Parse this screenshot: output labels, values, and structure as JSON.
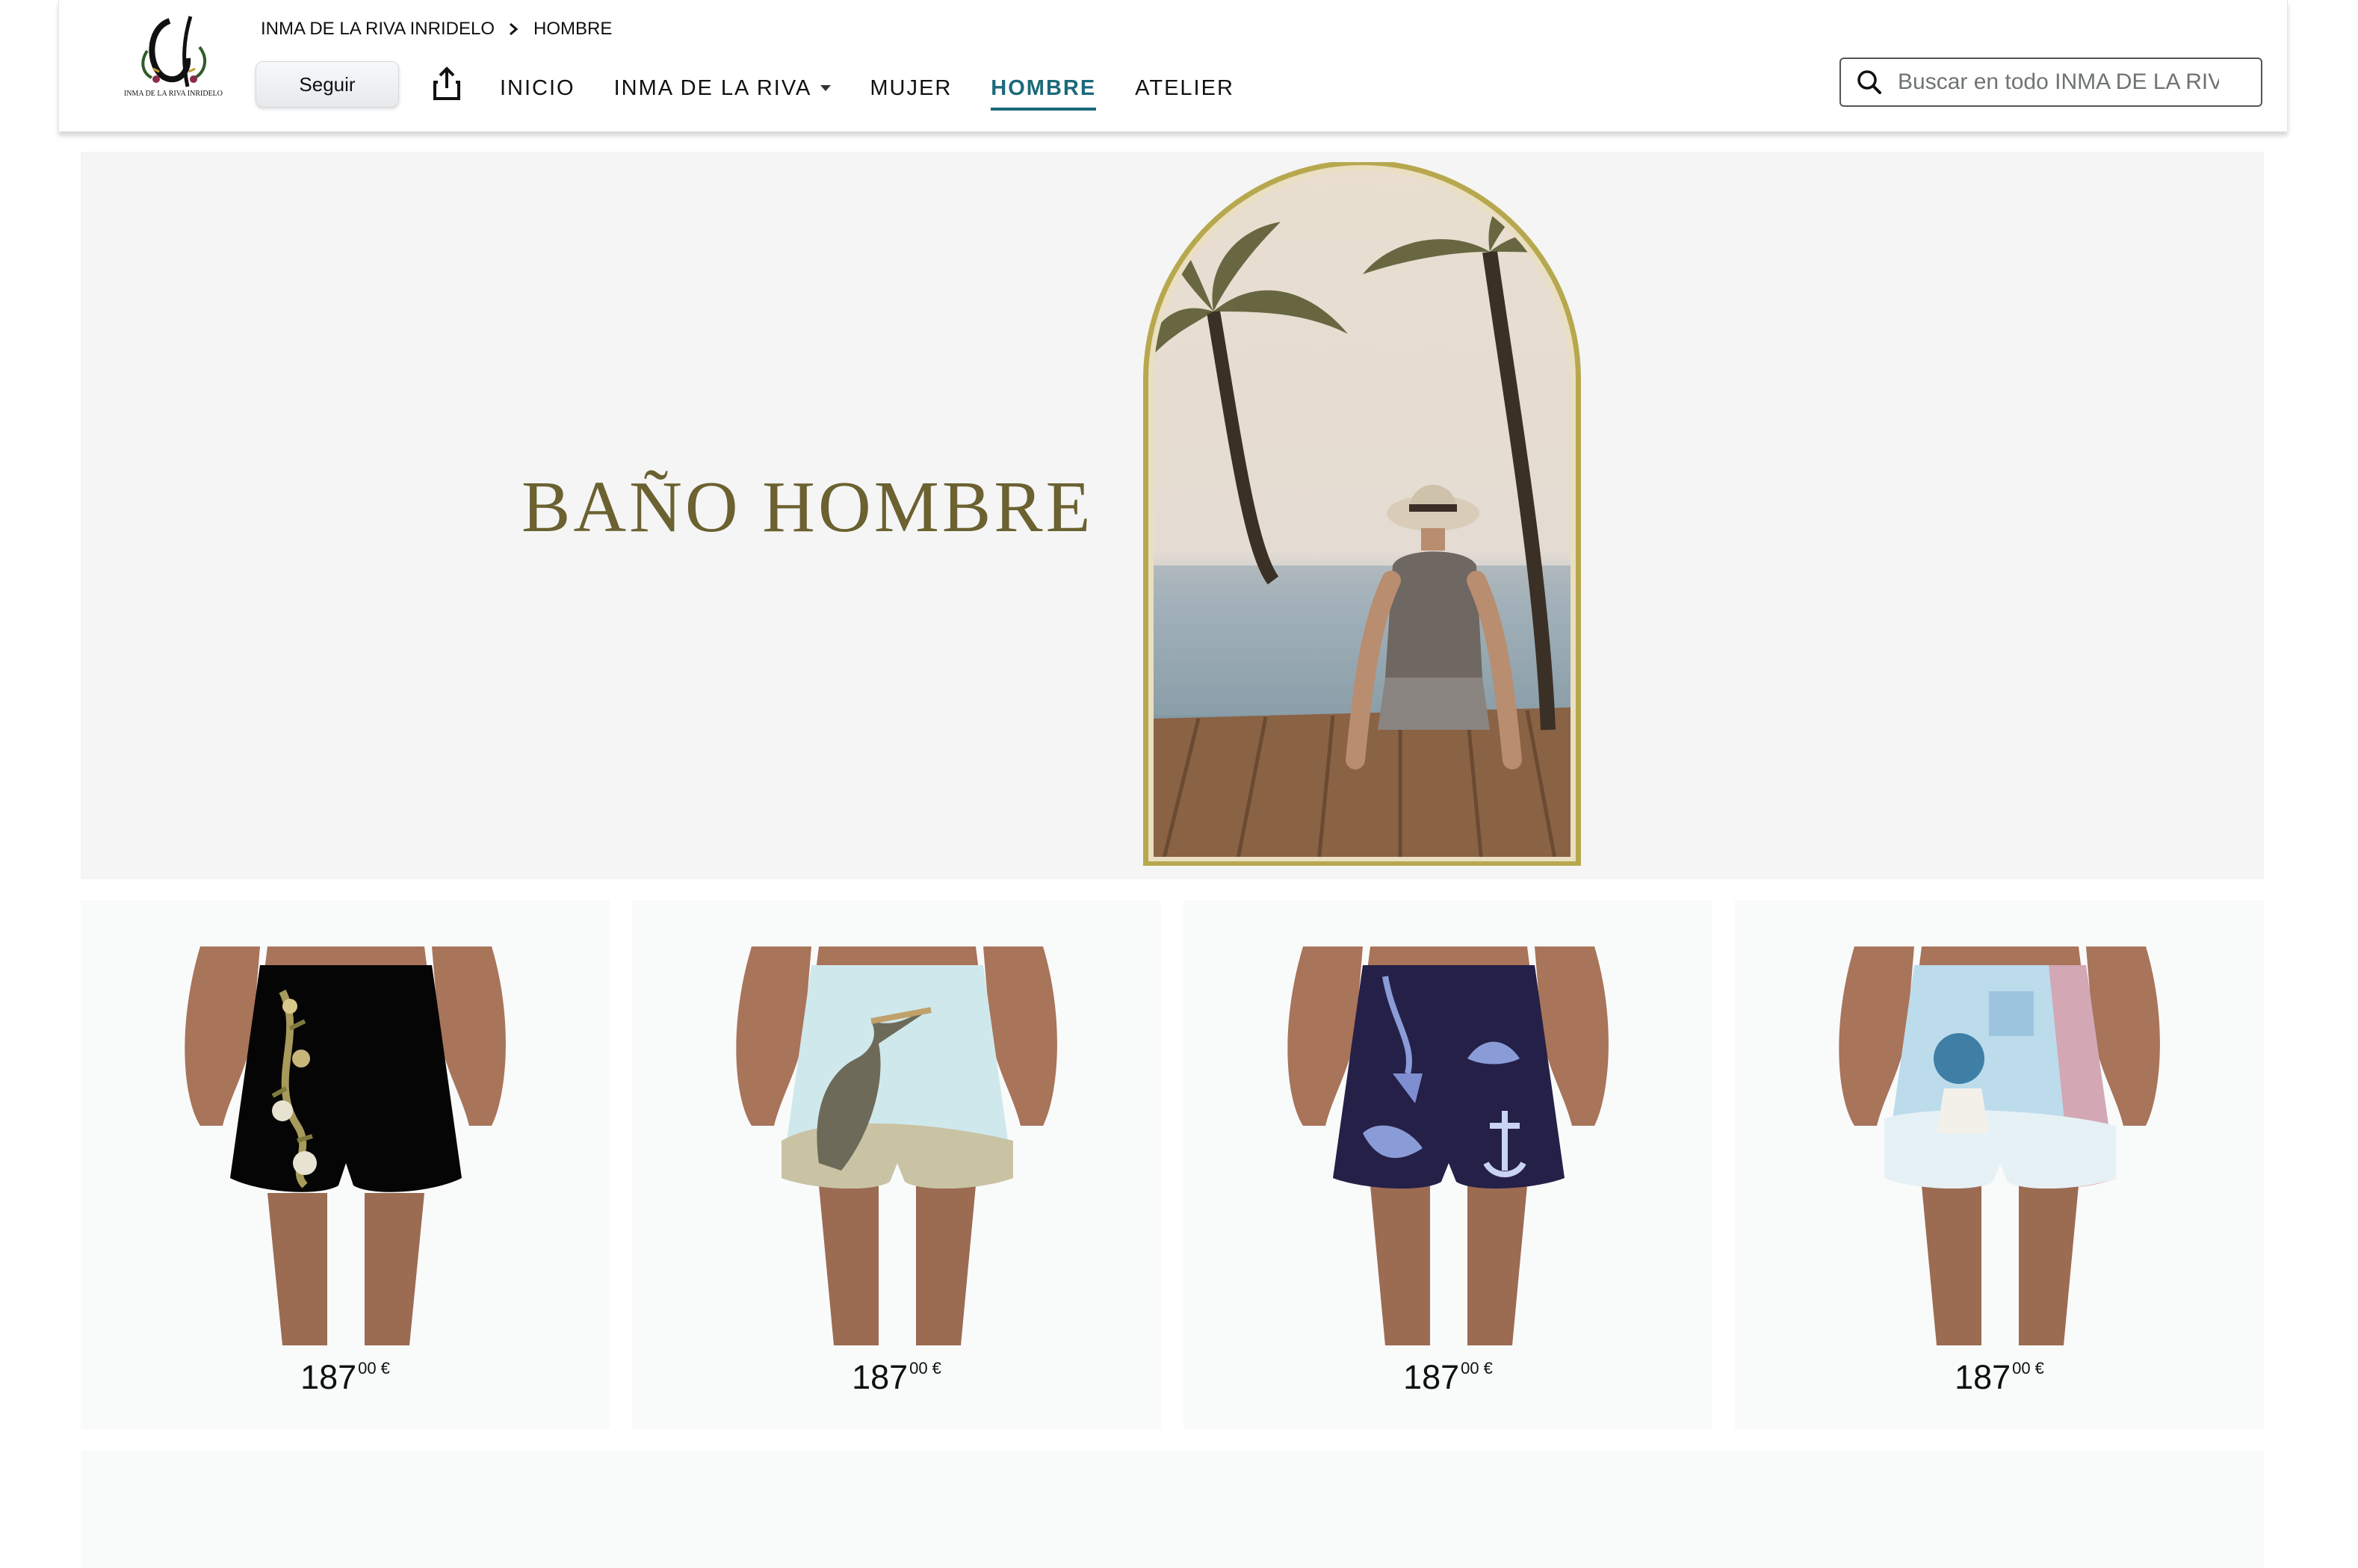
{
  "store": {
    "logo_icon": "brand-logo-icon",
    "logo_text": "INMA DE LA RIVA INRIDELO"
  },
  "breadcrumb": {
    "brand": "INMA DE LA RIVA INRIDELO",
    "current": "HOMBRE"
  },
  "header": {
    "follow_label": "Seguir",
    "share_icon": "share-icon"
  },
  "nav": {
    "items": [
      {
        "label": "INICIO",
        "active": false
      },
      {
        "label": "INMA DE LA RIVA",
        "active": false,
        "dropdown": true
      },
      {
        "label": "MUJER",
        "active": false
      },
      {
        "label": "HOMBRE",
        "active": true
      },
      {
        "label": "ATELIER",
        "active": false
      }
    ],
    "active_color": "#1b6a7a"
  },
  "search": {
    "placeholder": "Buscar en todo INMA DE LA RIVA",
    "icon": "search-icon"
  },
  "hero": {
    "title": "BAÑO HOMBRE",
    "title_color": "#6b6131",
    "frame_color": "#b7a84f"
  },
  "products": [
    {
      "price_whole": "187",
      "price_fraction": "00",
      "currency": "€"
    },
    {
      "price_whole": "187",
      "price_fraction": "00",
      "currency": "€"
    },
    {
      "price_whole": "187",
      "price_fraction": "00",
      "currency": "€"
    },
    {
      "price_whole": "187",
      "price_fraction": "00",
      "currency": "€"
    }
  ]
}
